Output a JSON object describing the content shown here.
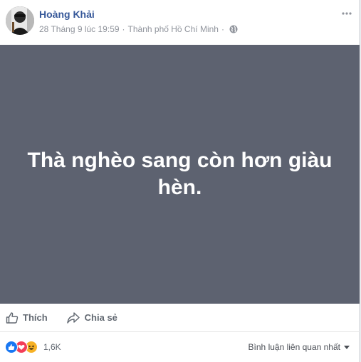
{
  "post": {
    "author": "Hoàng Khải",
    "date": "28 Tháng 9 lúc 19:59",
    "location": "Thành phố Hồ Chí Minh",
    "separator": "·",
    "status_text": "Thà nghèo sang còn hơn giàu hèn.",
    "status_bg_color": "#5d6270"
  },
  "actions": {
    "like_label": "Thích",
    "share_label": "Chia sẻ"
  },
  "footer": {
    "reaction_count": "1,6K",
    "reactions": [
      "like-icon",
      "love-icon",
      "haha-icon"
    ],
    "comment_filter": "Bình luận liên quan nhất"
  },
  "colors": {
    "author_link": "#365899",
    "meta": "#90949c",
    "like_blue": "#1877f2",
    "love_red": "#f33e58",
    "haha_yellow": "#f7b125"
  }
}
